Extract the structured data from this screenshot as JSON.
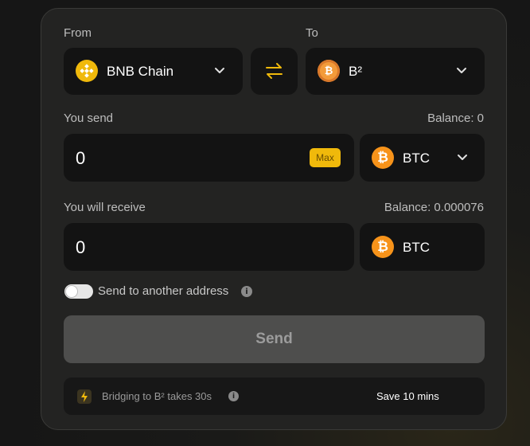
{
  "from": {
    "label": "From",
    "chain": "BNB Chain",
    "icon": "bnb-icon"
  },
  "to": {
    "label": "To",
    "chain": "B²",
    "icon": "b2-icon"
  },
  "swap_icon": "swap-arrows-icon",
  "send_section": {
    "label": "You send",
    "balance": "Balance: 0",
    "amount": "0",
    "max_label": "Max",
    "token": "BTC"
  },
  "receive_section": {
    "label": "You will receive",
    "balance": "Balance: 0.000076",
    "amount": "0",
    "token": "BTC"
  },
  "send_to_other": {
    "label": "Send to another address",
    "enabled": false
  },
  "send_button": "Send",
  "footer": {
    "bridging_text": "Bridging to B² takes 30s",
    "save_text": "Save 10 mins"
  },
  "colors": {
    "accent": "#f0b90b",
    "btc": "#f7931a",
    "card": "#232322",
    "field": "#131313"
  }
}
